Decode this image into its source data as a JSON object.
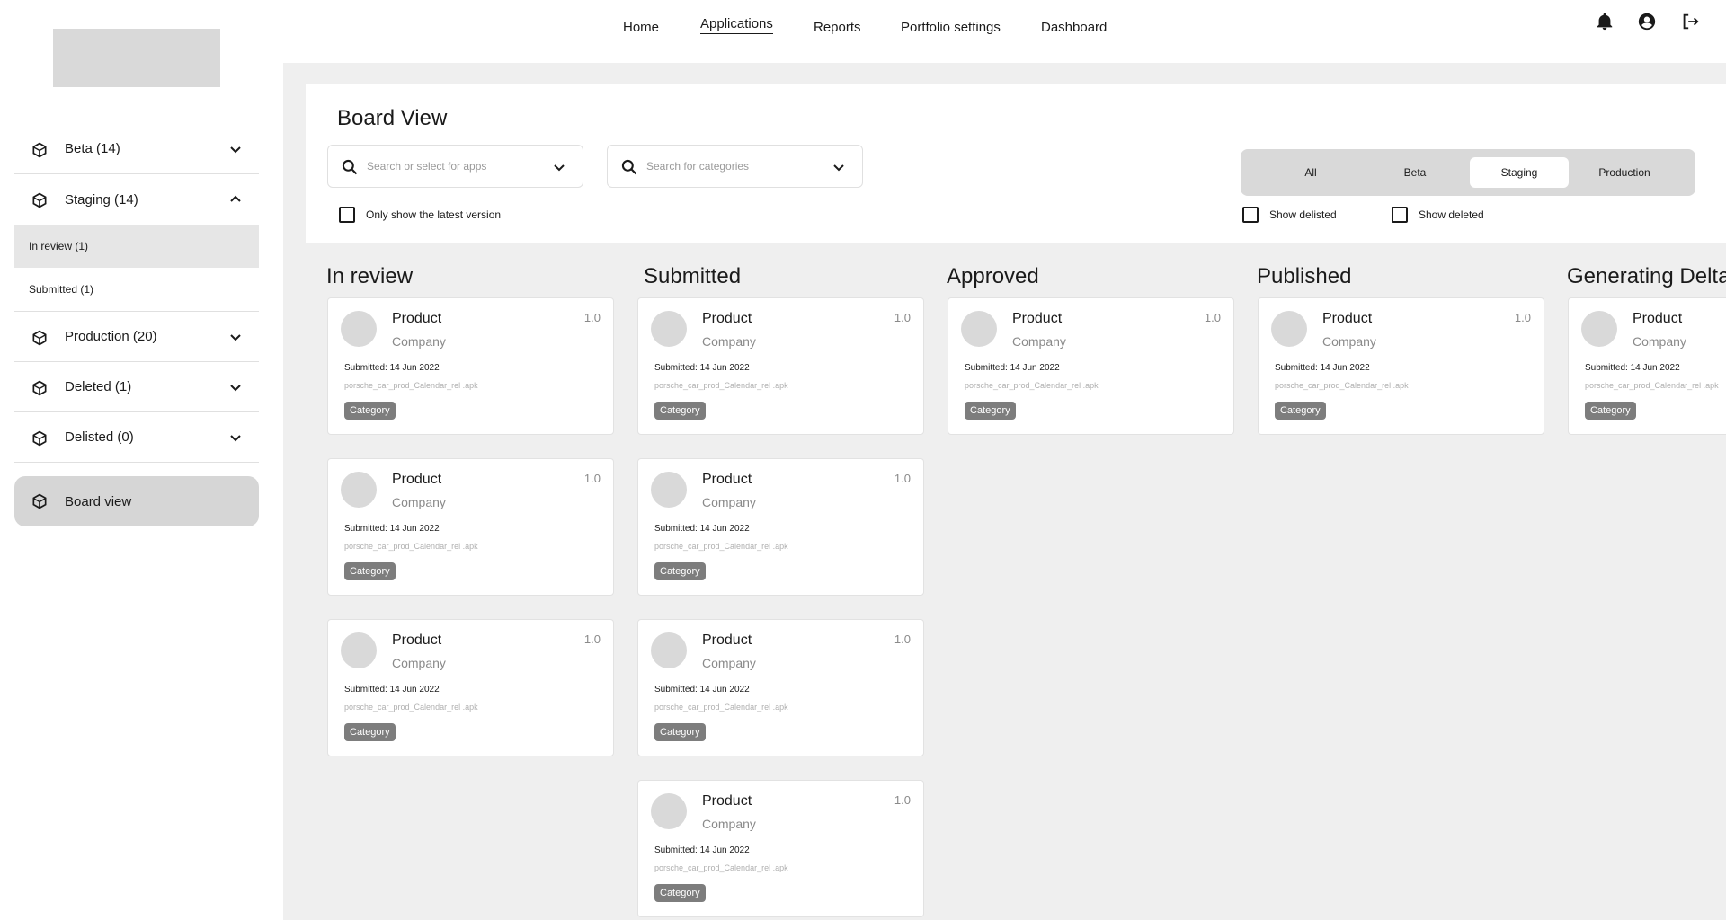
{
  "sidebar": {
    "items": [
      {
        "label": "Beta (14)"
      },
      {
        "label": "Staging (14)"
      },
      {
        "label": "Production (20)"
      },
      {
        "label": "Deleted (1)"
      },
      {
        "label": "Delisted (0)"
      }
    ],
    "staging_sub": [
      {
        "label": "In review (1)"
      },
      {
        "label": "Submitted (1)"
      }
    ],
    "board_view_label": "Board view"
  },
  "nav": {
    "items": [
      "Home",
      "Applications",
      "Reports",
      "Portfolio settings",
      "Dashboard"
    ],
    "active": "Applications"
  },
  "icons": {
    "notifications": "bell-icon",
    "account": "account-circle-icon",
    "logout": "logout-icon"
  },
  "filters": {
    "title": "Board View",
    "app_search_placeholder": "Search or select for apps",
    "category_search_placeholder": "Search for categories",
    "latest_version_label": "Only show the latest version",
    "show_delisted_label": "Show delisted",
    "show_deleted_label": "Show deleted",
    "segments": [
      "All",
      "Beta",
      "Staging",
      "Production"
    ],
    "active_segment": "Staging"
  },
  "card": {
    "product": "Product",
    "company": "Company",
    "version": "1.0",
    "submitted": "Submitted: 14 Jun 2022",
    "file": "porsche_car_prod_Calendar_rel .apk",
    "category": "Category"
  },
  "columns": [
    {
      "title": "In review",
      "card_count": 3
    },
    {
      "title": "Submitted",
      "card_count": 4
    },
    {
      "title": "Approved",
      "card_count": 1
    },
    {
      "title": "Published",
      "card_count": 1
    },
    {
      "title": "Generating Delta",
      "card_count": 1
    }
  ],
  "colors": {
    "background": "#efefef",
    "panel": "#ffffff",
    "segment_bg": "#d9d9d9",
    "active_sidebar": "#e6e6e6",
    "board_button": "#d6d6d6",
    "category_chip": "#7d7d7d",
    "placeholder": "#d9d9d9"
  }
}
